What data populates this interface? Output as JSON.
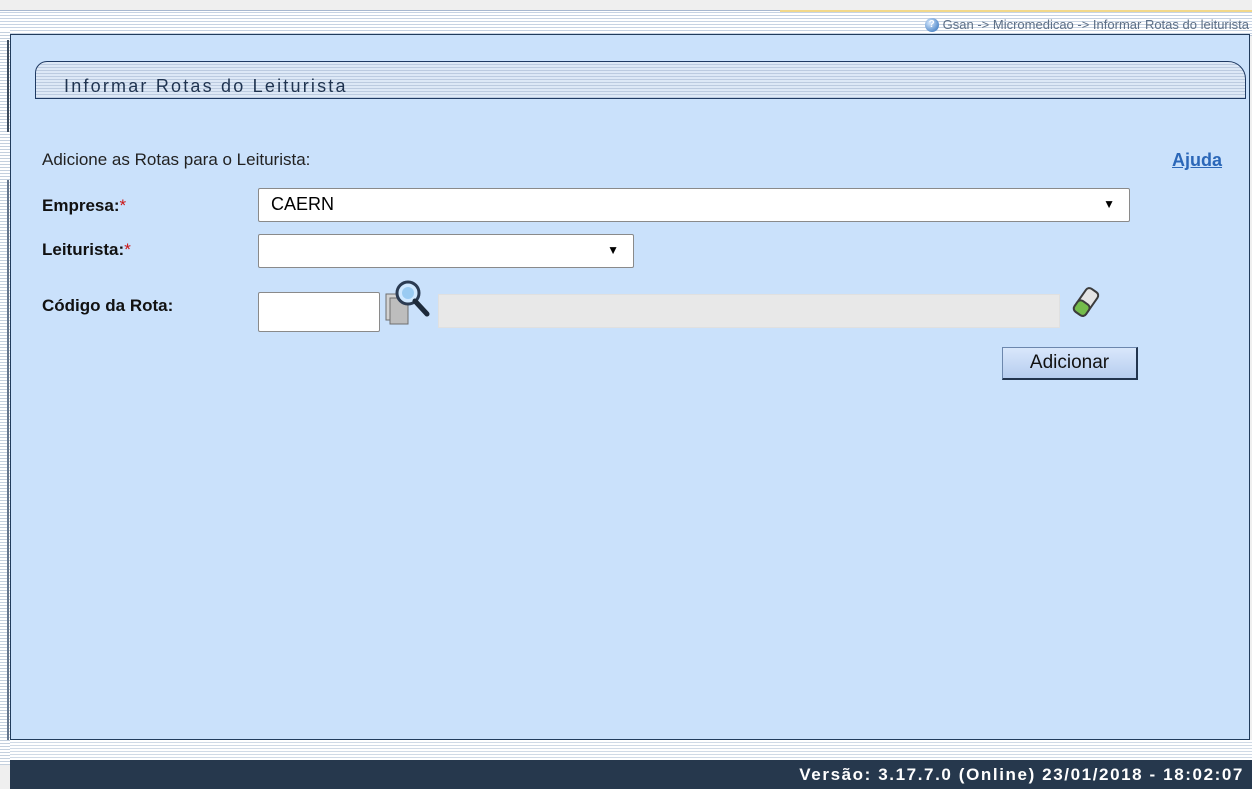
{
  "breadcrumb": {
    "text": "Gsan -> Micromedicao -> Informar Rotas do leiturista"
  },
  "page": {
    "title": "Informar Rotas do Leiturista",
    "instruction": "Adicione as Rotas para o Leiturista:",
    "help_link": "Ajuda"
  },
  "form": {
    "empresa": {
      "label": "Empresa:",
      "required_mark": "*",
      "selected": "CAERN"
    },
    "leiturista": {
      "label": "Leiturista:",
      "required_mark": "*",
      "selected": ""
    },
    "codigo_rota": {
      "label": "Código da Rota:",
      "value": "",
      "description": ""
    },
    "add_button": "Adicionar"
  },
  "icons": {
    "breadcrumb": "help-circle-icon",
    "search": "magnifier-document-icon",
    "clear": "eraser-icon",
    "dropdown": "triangle-down-icon"
  },
  "footer": {
    "version": "Versão: 3.17.7.0 (Online) 23/01/2018 - 18:02:07"
  }
}
